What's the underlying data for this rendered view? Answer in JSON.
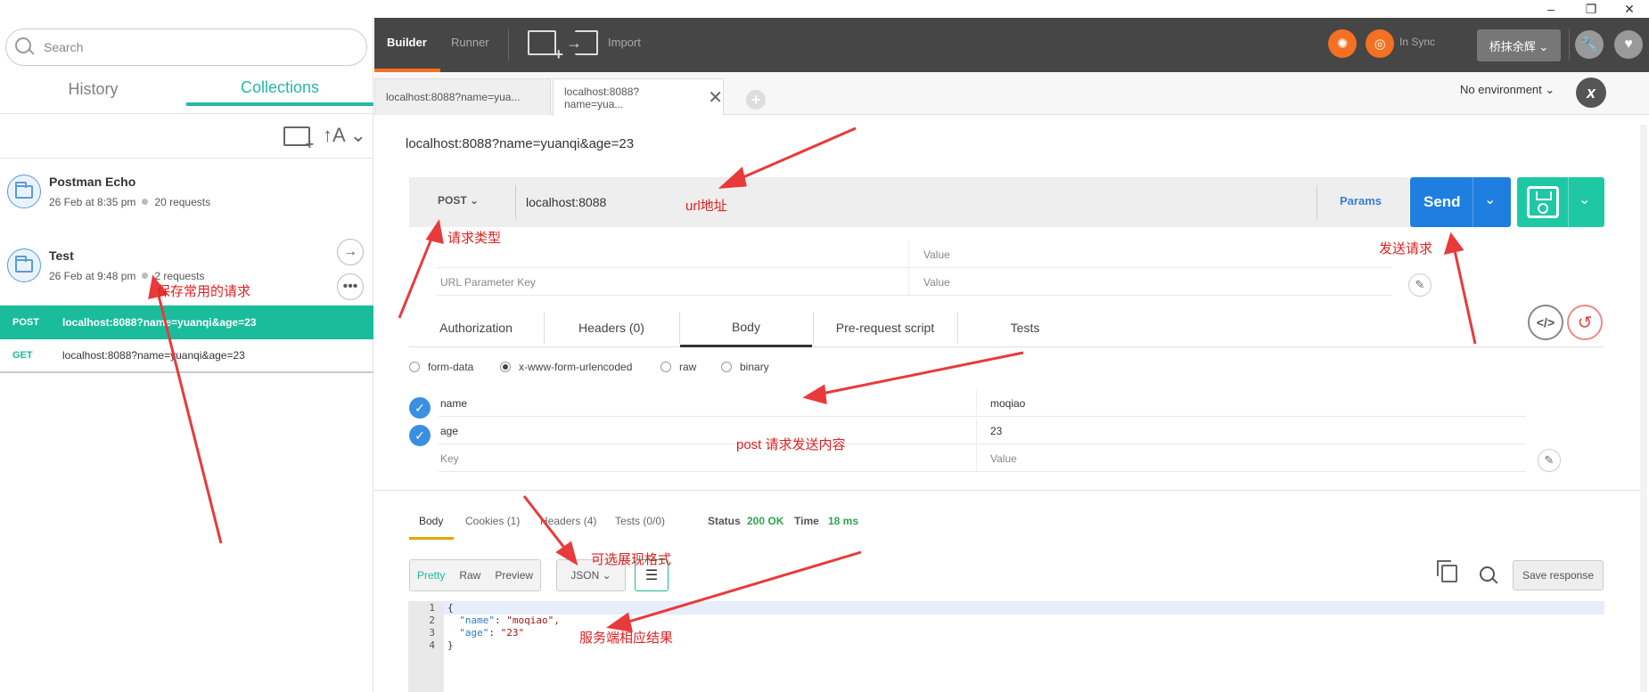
{
  "window": {
    "minimize": "–",
    "restore": "❐",
    "close": "✕"
  },
  "sidebar": {
    "search_placeholder": "Search",
    "tabs": [
      {
        "label": "History",
        "active": false
      },
      {
        "label": "Collections",
        "active": true
      }
    ],
    "sort_label": "↑A ⌄",
    "collections": [
      {
        "name": "Postman Echo",
        "date": "26 Feb at 8:35 pm",
        "count": "20 requests"
      },
      {
        "name": "Test",
        "date": "26 Feb at 9:48 pm",
        "count": "2 requests"
      }
    ],
    "requests": [
      {
        "method": "POST",
        "url": "localhost:8088?name=yuanqi&age=23",
        "active": true
      },
      {
        "method": "GET",
        "url": "localhost:8088?name=yuanqi&age=23",
        "active": false
      }
    ]
  },
  "topbar": {
    "builder": "Builder",
    "runner": "Runner",
    "import": "Import",
    "sync_status": "In Sync",
    "user": "桥抹余辉 ⌄"
  },
  "tabs": [
    {
      "label": "localhost:8088?name=yua...",
      "active": false
    },
    {
      "label": "localhost:8088?name=yua...",
      "active": true
    }
  ],
  "environment": "No environment ⌄",
  "request": {
    "title": "localhost:8088?name=yuanqi&age=23",
    "method": "POST ⌄",
    "url": "localhost:8088",
    "params_label": "Params",
    "send_label": "Send",
    "param_rows": [
      {
        "key": "",
        "value": "Value"
      },
      {
        "key": "URL Parameter Key",
        "value": "Value"
      }
    ]
  },
  "subtabs": [
    "Authorization",
    "Headers (0)",
    "Body",
    "Pre-request script",
    "Tests"
  ],
  "body_modes": [
    {
      "label": "form-data",
      "selected": false
    },
    {
      "label": "x-www-form-urlencoded",
      "selected": true
    },
    {
      "label": "raw",
      "selected": false
    },
    {
      "label": "binary",
      "selected": false
    }
  ],
  "body_rows": [
    {
      "key": "name",
      "value": "moqiao"
    },
    {
      "key": "age",
      "value": "23"
    },
    {
      "key": "Key",
      "value": "Value"
    }
  ],
  "response": {
    "tabs": [
      "Body",
      "Cookies (1)",
      "Headers (4)",
      "Tests (0/0)"
    ],
    "status_label": "Status",
    "status_value": "200 OK",
    "time_label": "Time",
    "time_value": "18 ms",
    "formats": [
      "Pretty",
      "Raw",
      "Preview"
    ],
    "lang": "JSON ⌄",
    "save_response": "Save response",
    "code_lines": [
      {
        "n": "1",
        "text": "{"
      },
      {
        "n": "2",
        "key": "\"name\"",
        "val": "\"moqiao\","
      },
      {
        "n": "3",
        "key": "\"age\"",
        "val": "\"23\""
      },
      {
        "n": "4",
        "text": "}"
      }
    ]
  },
  "annotations": {
    "url": "url地址",
    "method": "请求类型",
    "send": "发送请求",
    "saved": "保存常用的请求",
    "body": "post 请求发送内容",
    "format": "可选展现格式",
    "result": "服务端相应结果"
  }
}
